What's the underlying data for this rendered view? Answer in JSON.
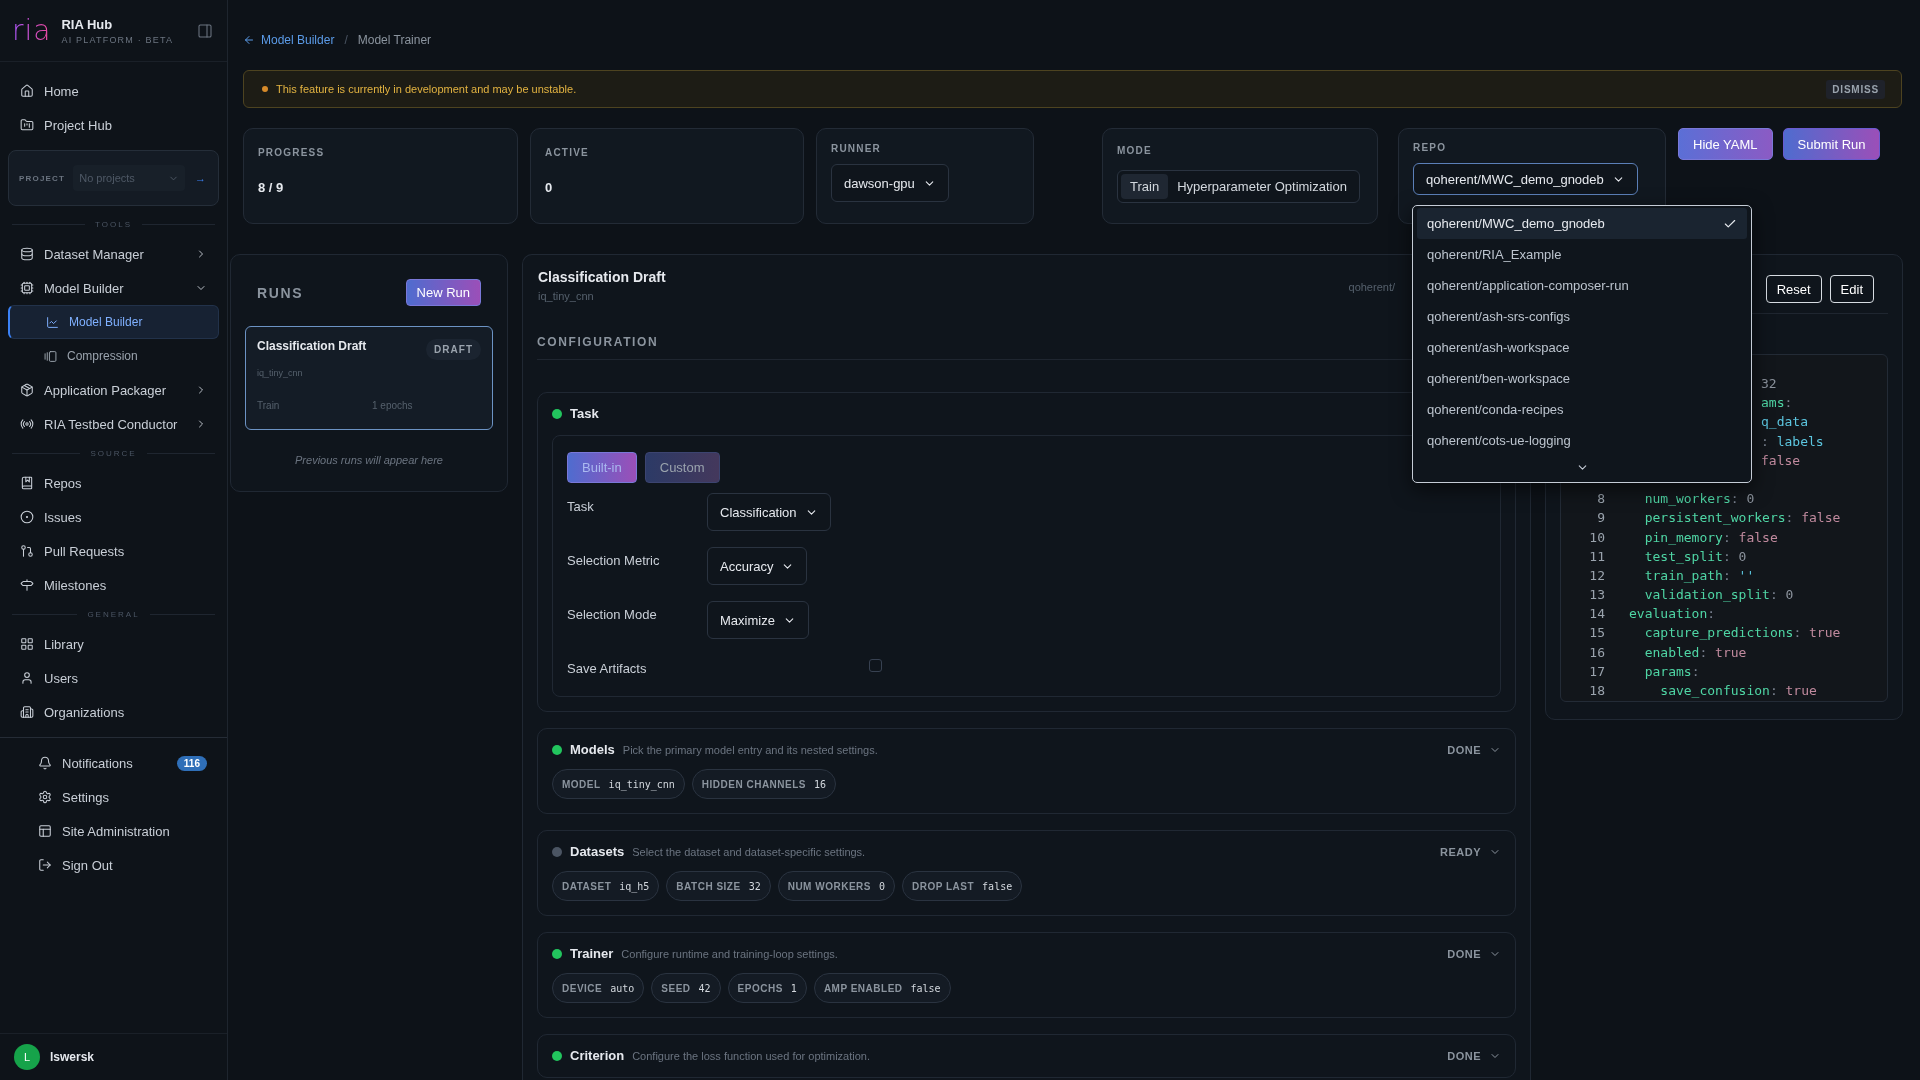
{
  "sidebar": {
    "brand": {
      "logo": "ria",
      "title": "RIA Hub",
      "subtitle": "AI PLATFORM · BETA"
    },
    "top_items": [
      {
        "label": "Home",
        "selected": false
      },
      {
        "label": "Project Hub",
        "selected": false
      }
    ],
    "project": {
      "label": "PROJECT",
      "placeholder": "No projects",
      "go": "→"
    },
    "groups": [
      {
        "heading": "TOOLS",
        "items": [
          {
            "label": "Dataset Manager",
            "selected": false,
            "expanded": false
          },
          {
            "label": "Model Builder",
            "selected": false,
            "expanded": true,
            "children": [
              {
                "label": "Model Builder",
                "selected": true
              },
              {
                "label": "Compression",
                "selected": false
              }
            ]
          },
          {
            "label": "Application Packager",
            "selected": false,
            "expanded": false
          },
          {
            "label": "RIA Testbed Conductor",
            "selected": false,
            "expanded": false
          }
        ]
      },
      {
        "heading": "SOURCE",
        "items": [
          {
            "label": "Repos",
            "selected": false
          },
          {
            "label": "Issues",
            "selected": false
          },
          {
            "label": "Pull Requests",
            "selected": false
          },
          {
            "label": "Milestones",
            "selected": false
          }
        ]
      },
      {
        "heading": "GENERAL",
        "items": [
          {
            "label": "Library",
            "selected": false
          },
          {
            "label": "Users",
            "selected": false
          },
          {
            "label": "Organizations",
            "selected": false
          }
        ]
      }
    ],
    "bottom_items": [
      {
        "label": "Notifications",
        "selected": false,
        "badge": "116"
      },
      {
        "label": "Settings",
        "selected": false
      },
      {
        "label": "Site Administration",
        "selected": false
      },
      {
        "label": "Sign Out",
        "selected": false
      }
    ],
    "user": {
      "initial": "L",
      "name": "lswersk"
    }
  },
  "breadcrumb": {
    "back": "Model Builder",
    "separator": "/",
    "current": "Model Trainer"
  },
  "alert": {
    "message": "This feature is currently in development and may be unstable.",
    "action": "DISMISS"
  },
  "stats": [
    {
      "label": "PROGRESS",
      "value": "8 / 9"
    },
    {
      "label": "ACTIVE",
      "value": "0"
    }
  ],
  "runner": {
    "label": "RUNNER",
    "value": "dawson-gpu"
  },
  "mode": {
    "label": "MODE",
    "options": [
      {
        "label": "Train",
        "selected": true
      },
      {
        "label": "Hyperparameter Optimization",
        "selected": false
      }
    ]
  },
  "repo": {
    "label": "REPO",
    "value": "qoherent/MWC_demo_gnodeb",
    "expanded": true,
    "options": [
      {
        "label": "qoherent/MWC_demo_gnodeb",
        "selected": true
      },
      {
        "label": "qoherent/RIA_Example",
        "selected": false
      },
      {
        "label": "qoherent/application-composer-run",
        "selected": false
      },
      {
        "label": "qoherent/ash-srs-configs",
        "selected": false
      },
      {
        "label": "qoherent/ash-workspace",
        "selected": false
      },
      {
        "label": "qoherent/ben-workspace",
        "selected": false
      },
      {
        "label": "qoherent/conda-recipes",
        "selected": false
      },
      {
        "label": "qoherent/cots-ue-logging",
        "selected": false
      }
    ]
  },
  "actions": [
    {
      "label": "Hide YAML"
    },
    {
      "label": "Submit Run"
    }
  ],
  "runs": {
    "title": "RUNS",
    "new_button": "New Run",
    "items": [
      {
        "name": "Classification Draft",
        "badge": "DRAFT",
        "model": "iq_tiny_cnn",
        "mode": "Train",
        "epochs": "1 epochs",
        "selected": true
      }
    ],
    "empty_hint": "Previous runs will appear here"
  },
  "editor": {
    "title": "Classification Draft",
    "subtitle": "iq_tiny_cnn",
    "repo": "qoherent/",
    "section_label": "CONFIGURATION",
    "task": {
      "title": "Task",
      "color": "#22c55e",
      "tabs": [
        {
          "label": "Built-in",
          "selected": true
        },
        {
          "label": "Custom",
          "selected": false
        }
      ],
      "fields": [
        {
          "kind": "select",
          "label": "Task",
          "value": "Classification"
        },
        {
          "kind": "select",
          "label": "Selection Metric",
          "value": "Accuracy"
        },
        {
          "kind": "select",
          "label": "Selection Mode",
          "value": "Maximize"
        },
        {
          "kind": "checkbox",
          "label": "Save Artifacts",
          "checked": false
        }
      ]
    },
    "sections": [
      {
        "title": "Models",
        "description": "Pick the primary model entry and its nested settings.",
        "status": "DONE",
        "color": "#22c55e",
        "chips": [
          {
            "label": "MODEL",
            "value": "iq_tiny_cnn"
          },
          {
            "label": "HIDDEN CHANNELS",
            "value": "16"
          }
        ]
      },
      {
        "title": "Datasets",
        "description": "Select the dataset and dataset-specific settings.",
        "status": "READY",
        "color": "#4b5563",
        "chips": [
          {
            "label": "DATASET",
            "value": "iq_h5"
          },
          {
            "label": "BATCH SIZE",
            "value": "32"
          },
          {
            "label": "NUM WORKERS",
            "value": "0"
          },
          {
            "label": "DROP LAST",
            "value": "false"
          }
        ]
      },
      {
        "title": "Trainer",
        "description": "Configure runtime and training-loop settings.",
        "status": "DONE",
        "color": "#22c55e",
        "chips": [
          {
            "label": "DEVICE",
            "value": "auto"
          },
          {
            "label": "SEED",
            "value": "42"
          },
          {
            "label": "EPOCHS",
            "value": "1"
          },
          {
            "label": "AMP ENABLED",
            "value": "false"
          }
        ]
      },
      {
        "title": "Criterion",
        "description": "Configure the loss function used for optimization.",
        "status": "DONE",
        "color": "#22c55e"
      }
    ]
  },
  "yaml": {
    "buttons": [
      {
        "label": "Reset"
      },
      {
        "label": "Edit"
      }
    ],
    "fragments": [
      {
        "tokens": [
          {
            "kind": "number",
            "text": "32"
          }
        ]
      },
      {
        "tokens": [
          {
            "kind": "key",
            "text": "ams"
          },
          {
            "kind": "punct",
            "text": ":"
          }
        ]
      },
      {
        "tokens": [
          {
            "kind": "string",
            "text": "q_data"
          }
        ]
      },
      {
        "tokens": [
          {
            "kind": "punct",
            "text": ": "
          },
          {
            "kind": "string",
            "text": "labels"
          }
        ]
      },
      {
        "tokens": [
          {
            "kind": "bool",
            "text": "false"
          }
        ]
      }
    ],
    "lines": [
      {
        "num": "8",
        "tokens": [
          {
            "kind": "key",
            "text": "  num_workers"
          },
          {
            "kind": "punct",
            "text": ": "
          },
          {
            "kind": "number",
            "text": "0"
          }
        ]
      },
      {
        "num": "9",
        "tokens": [
          {
            "kind": "key",
            "text": "  persistent_workers"
          },
          {
            "kind": "punct",
            "text": ": "
          },
          {
            "kind": "bool",
            "text": "false"
          }
        ]
      },
      {
        "num": "10",
        "tokens": [
          {
            "kind": "key",
            "text": "  pin_memory"
          },
          {
            "kind": "punct",
            "text": ": "
          },
          {
            "kind": "bool",
            "text": "false"
          }
        ]
      },
      {
        "num": "11",
        "tokens": [
          {
            "kind": "key",
            "text": "  test_split"
          },
          {
            "kind": "punct",
            "text": ": "
          },
          {
            "kind": "number",
            "text": "0"
          }
        ]
      },
      {
        "num": "12",
        "tokens": [
          {
            "kind": "key",
            "text": "  train_path"
          },
          {
            "kind": "punct",
            "text": ": "
          },
          {
            "kind": "string",
            "text": "''"
          }
        ]
      },
      {
        "num": "13",
        "tokens": [
          {
            "kind": "key",
            "text": "  validation_split"
          },
          {
            "kind": "punct",
            "text": ": "
          },
          {
            "kind": "number",
            "text": "0"
          }
        ]
      },
      {
        "num": "14",
        "tokens": [
          {
            "kind": "key",
            "text": "evaluation"
          },
          {
            "kind": "punct",
            "text": ":"
          }
        ]
      },
      {
        "num": "15",
        "tokens": [
          {
            "kind": "key",
            "text": "  capture_predictions"
          },
          {
            "kind": "punct",
            "text": ": "
          },
          {
            "kind": "bool",
            "text": "true"
          }
        ]
      },
      {
        "num": "16",
        "tokens": [
          {
            "kind": "key",
            "text": "  enabled"
          },
          {
            "kind": "punct",
            "text": ": "
          },
          {
            "kind": "bool",
            "text": "true"
          }
        ]
      },
      {
        "num": "17",
        "tokens": [
          {
            "kind": "key",
            "text": "  params"
          },
          {
            "kind": "punct",
            "text": ":"
          }
        ]
      },
      {
        "num": "18",
        "tokens": [
          {
            "kind": "key",
            "text": "    save_confusion"
          },
          {
            "kind": "punct",
            "text": ": "
          },
          {
            "kind": "bool",
            "text": "true"
          }
        ]
      }
    ]
  }
}
